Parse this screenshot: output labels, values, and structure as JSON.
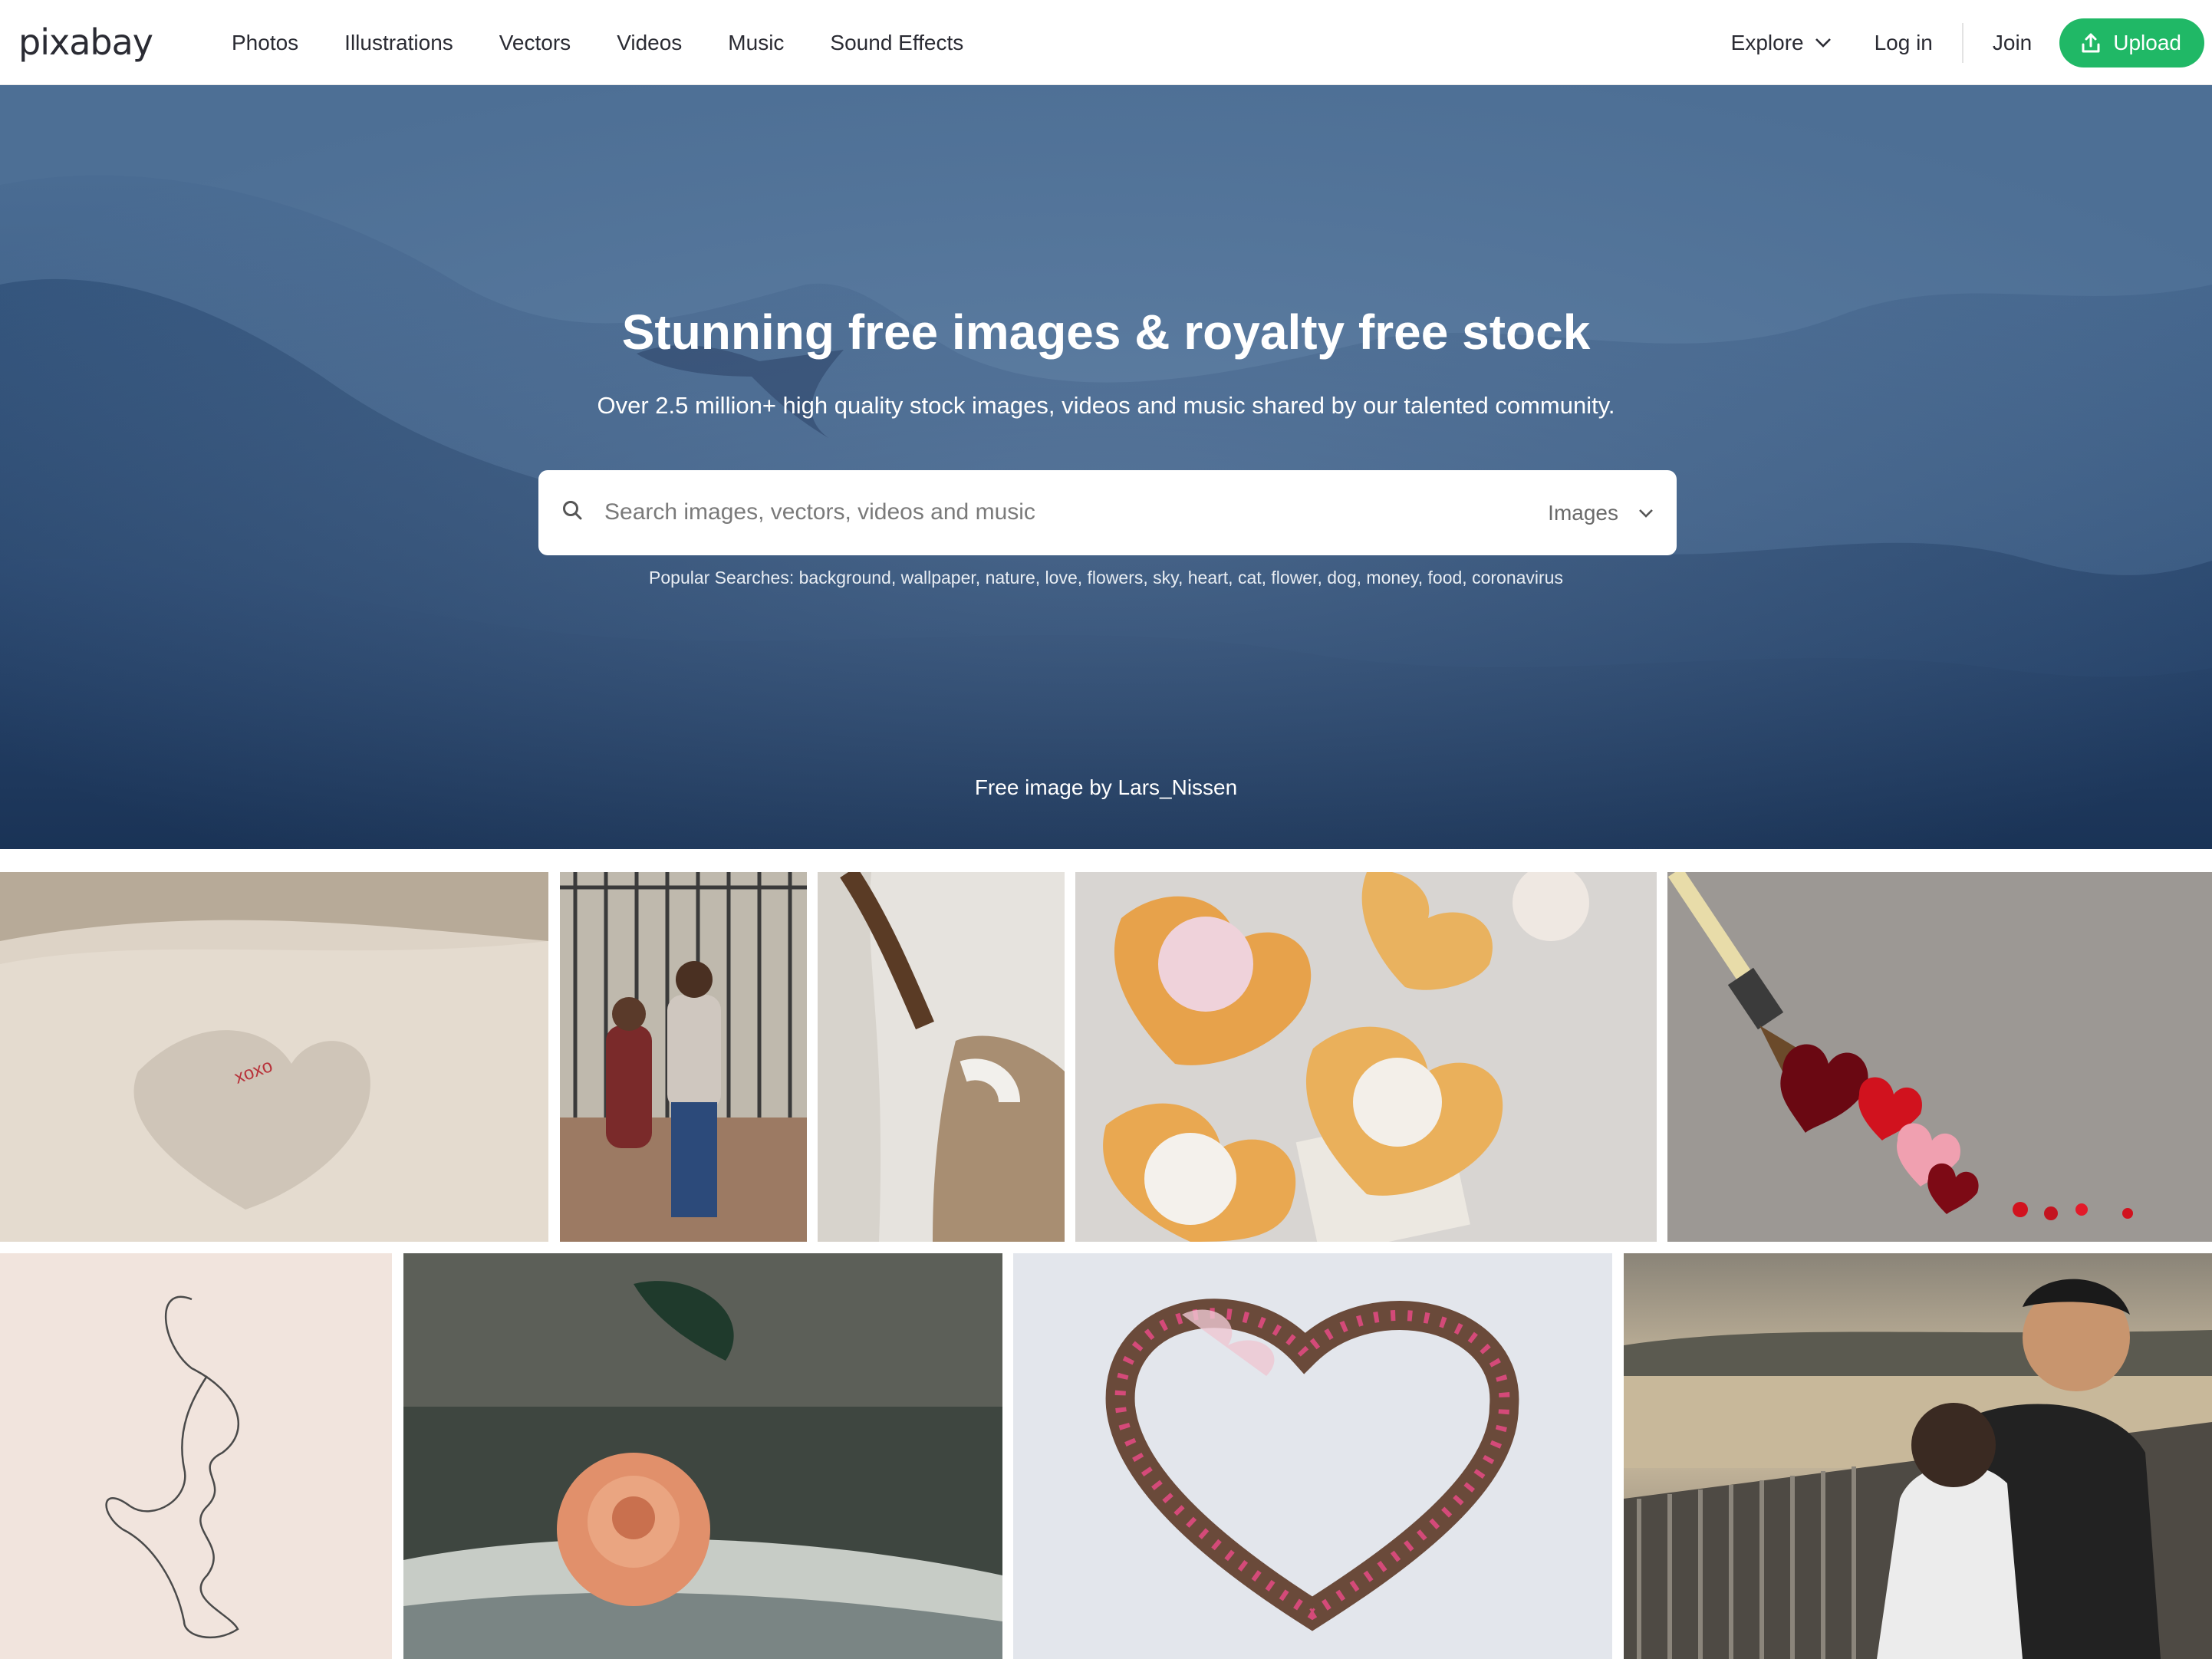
{
  "header": {
    "logo": "pixabay",
    "nav": [
      "Photos",
      "Illustrations",
      "Vectors",
      "Videos",
      "Music",
      "Sound Effects"
    ],
    "explore_label": "Explore",
    "login_label": "Log in",
    "join_label": "Join",
    "upload_label": "Upload"
  },
  "hero": {
    "title": "Stunning free images & royalty free stock",
    "subtitle": "Over 2.5 million+ high quality stock images, videos and music shared by our talented community.",
    "search_placeholder": "Search images, vectors, videos and music",
    "search_type": "Images",
    "popular_searches": "Popular Searches: background, wallpaper, nature, love, flowers, sky, heart, cat, flower, dog, money, food, coronavirus",
    "credit": "Free image by Lars_Nissen"
  },
  "colors": {
    "accent": "#20b866",
    "hero_dark": "#223f66"
  },
  "gallery": {
    "row1": [
      "linen-heart-xoxo-photo",
      "couple-at-gate-photo",
      "coat-closeup-photo",
      "heart-waffles-ice-cream-photo",
      "paintbrush-hearts-photo"
    ],
    "row2": [
      "line-art-faces-illustration",
      "rose-on-book-photo",
      "heart-wreath-photo",
      "couple-hugging-lake-photo"
    ]
  }
}
